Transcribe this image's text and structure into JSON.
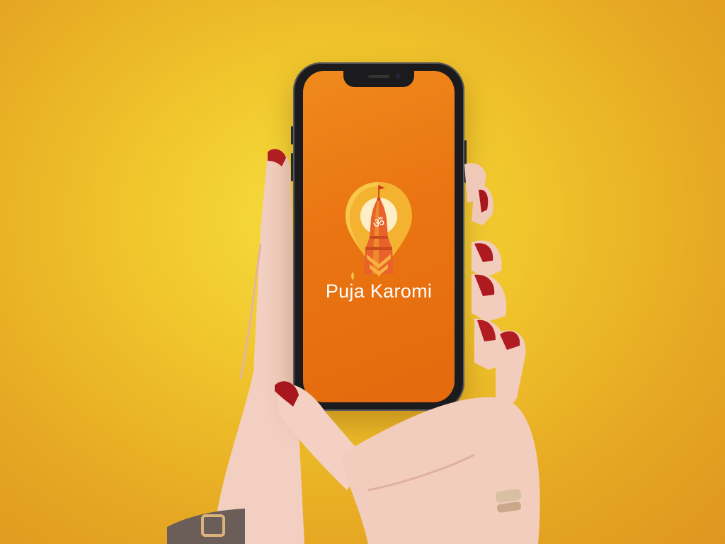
{
  "app": {
    "name": "Puja Karomi",
    "logo_symbol": "ॐ"
  },
  "colors": {
    "background": "#f0c52c",
    "screen": "#ea7412",
    "pin": "#f3b331",
    "temple": "#e8622a"
  },
  "icons": [
    "map-pin-icon",
    "temple-icon",
    "om-icon",
    "flag-icon",
    "flame-icon"
  ]
}
